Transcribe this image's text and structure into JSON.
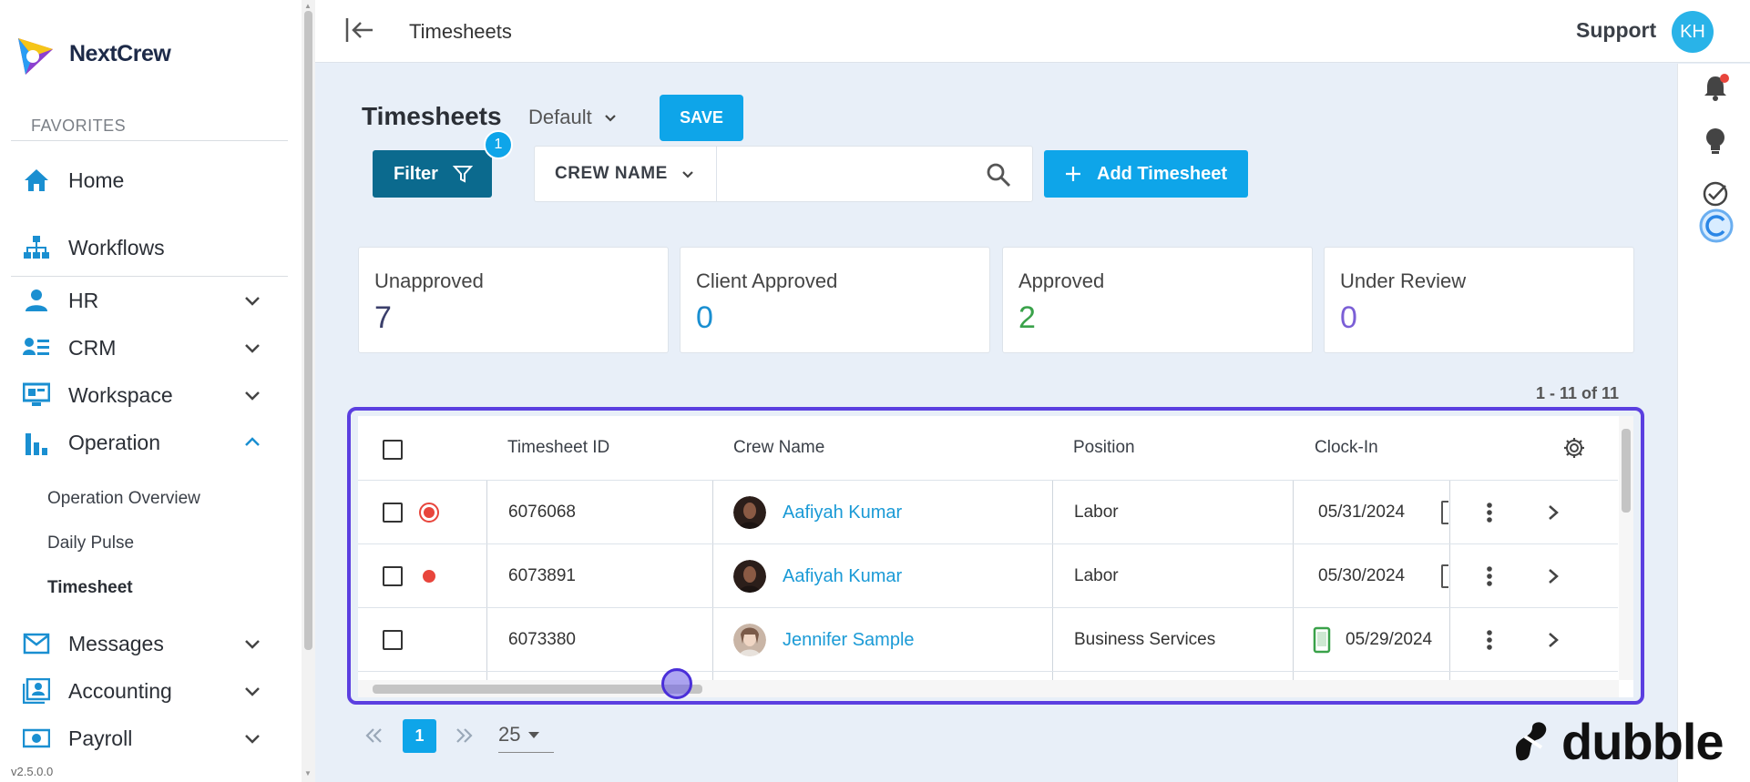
{
  "app": {
    "name": "NextCrew",
    "version": "v2.5.0.0"
  },
  "sidebar": {
    "favorites_label": "FAVORITES",
    "items": [
      {
        "label": "Home"
      },
      {
        "label": "Workflows"
      },
      {
        "label": "HR"
      },
      {
        "label": "CRM"
      },
      {
        "label": "Workspace"
      },
      {
        "label": "Operation"
      },
      {
        "label": "Messages"
      },
      {
        "label": "Accounting"
      },
      {
        "label": "Payroll"
      }
    ],
    "operation_sub": [
      "Operation Overview",
      "Daily Pulse",
      "Timesheet"
    ]
  },
  "topbar": {
    "title": "Timesheets",
    "support": "Support",
    "avatar_initials": "KH"
  },
  "toolbar": {
    "heading": "Timesheets",
    "view": "Default",
    "save_label": "SAVE",
    "filter_label": "Filter",
    "filter_count": "1",
    "search_field": "CREW NAME",
    "search_value": "",
    "add_label": "Add Timesheet"
  },
  "stats": [
    {
      "label": "Unapproved",
      "value": "7",
      "color": "#3b3f6b"
    },
    {
      "label": "Client Approved",
      "value": "0",
      "color": "#1a8fd1"
    },
    {
      "label": "Approved",
      "value": "2",
      "color": "#3aa24a"
    },
    {
      "label": "Under Review",
      "value": "0",
      "color": "#7b5fd6"
    }
  ],
  "table": {
    "range": "1 - 11 of 11",
    "columns": [
      "Timesheet ID",
      "Crew Name",
      "Position",
      "Clock-In"
    ],
    "rows": [
      {
        "id": "6076068",
        "crew": "Aafiyah Kumar",
        "position": "Labor",
        "clock_in": "05/31/2024",
        "status": "ring"
      },
      {
        "id": "6073891",
        "crew": "Aafiyah Kumar",
        "position": "Labor",
        "clock_in": "05/30/2024",
        "status": "dot"
      },
      {
        "id": "6073380",
        "crew": "Jennifer Sample",
        "position": "Business Services",
        "clock_in": "05/29/2024",
        "status": "none"
      }
    ]
  },
  "pagination": {
    "current": "1",
    "per_page": "25"
  },
  "watermark": "dubble",
  "colors": {
    "primary": "#0ea5e9",
    "filter": "#0b6a8e",
    "highlight": "#5b3fe0",
    "status_red": "#e8453c"
  }
}
